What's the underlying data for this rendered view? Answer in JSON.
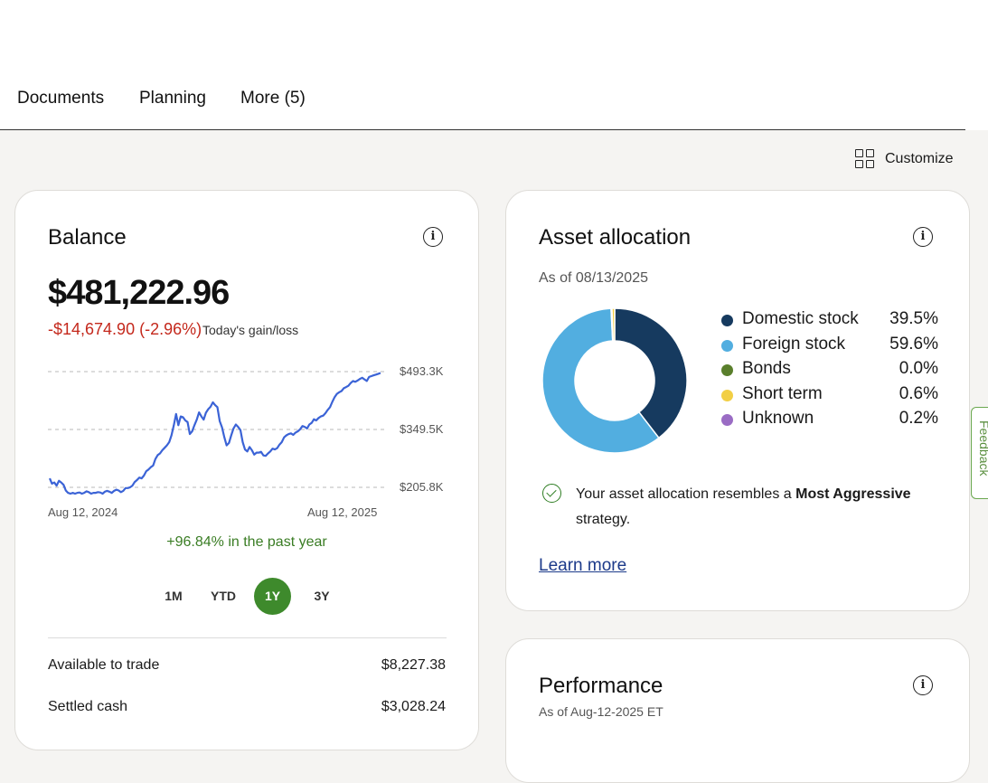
{
  "tabs": [
    {
      "label": "Documents"
    },
    {
      "label": "Planning"
    },
    {
      "label": "More (5)"
    }
  ],
  "customize": {
    "label": "Customize",
    "icon": "grid-icon"
  },
  "balance": {
    "title": "Balance",
    "amount": "$481,222.96",
    "change": "-$14,674.90 (-2.96%)",
    "change_label": "Today's gain/loss",
    "gain_text": "+96.84% in the past year",
    "ranges": [
      "1M",
      "YTD",
      "1Y",
      "3Y"
    ],
    "active_range": "1Y",
    "rows": [
      {
        "label": "Available to trade",
        "value": "$8,227.38"
      },
      {
        "label": "Settled cash",
        "value": "$3,028.24"
      }
    ]
  },
  "chart_data": {
    "type": "line",
    "x_start": "Aug 12, 2024",
    "x_end": "Aug 12, 2025",
    "ytick_labels": [
      "$493.3K",
      "$349.5K",
      "$205.8K"
    ],
    "ylim": [
      205.8,
      493.3
    ],
    "y_unit": "$K",
    "grid": "dashed horizontal",
    "color": "#3b63d6",
    "values": [
      228,
      215,
      218,
      210,
      222,
      218,
      212,
      198,
      192,
      190,
      192,
      190,
      192,
      193,
      190,
      192,
      196,
      194,
      190,
      192,
      192,
      194,
      193,
      190,
      195,
      197,
      195,
      192,
      197,
      200,
      198,
      194,
      197,
      204,
      204,
      206,
      210,
      219,
      224,
      230,
      228,
      235,
      246,
      250,
      256,
      260,
      276,
      286,
      290,
      298,
      304,
      310,
      318,
      335,
      360,
      388,
      360,
      382,
      380,
      372,
      368,
      338,
      345,
      360,
      374,
      392,
      382,
      374,
      391,
      400,
      406,
      417,
      410,
      405,
      370,
      355,
      330,
      310,
      316,
      335,
      352,
      362,
      356,
      348,
      318,
      300,
      295,
      306,
      298,
      287,
      292,
      292,
      294,
      285,
      284,
      290,
      295,
      302,
      300,
      303,
      312,
      318,
      330,
      335,
      338,
      340,
      336,
      342,
      345,
      350,
      358,
      356,
      352,
      362,
      366,
      375,
      372,
      378,
      382,
      384,
      390,
      398,
      405,
      418,
      430,
      438,
      442,
      445,
      452,
      455,
      458,
      465,
      470,
      468,
      471,
      475,
      478,
      474,
      470,
      480,
      482,
      484,
      486,
      488,
      490
    ]
  },
  "asset_allocation": {
    "title": "Asset allocation",
    "as_of": "As of 08/13/2025",
    "items": [
      {
        "name": "Domestic stock",
        "pct": "39.5%",
        "value": 39.5,
        "color": "#163a5f"
      },
      {
        "name": "Foreign stock",
        "pct": "59.6%",
        "value": 59.6,
        "color": "#52aee0"
      },
      {
        "name": "Bonds",
        "pct": "0.0%",
        "value": 0.0,
        "color": "#5a7f2c"
      },
      {
        "name": "Short term",
        "pct": "0.6%",
        "value": 0.6,
        "color": "#f2cf45"
      },
      {
        "name": "Unknown",
        "pct": "0.2%",
        "value": 0.2,
        "color": "#9a6cc4"
      }
    ],
    "resembles_prefix": "Your asset allocation resembles a ",
    "resembles_bold": "Most Aggressive",
    "resembles_suffix": " strategy.",
    "learn_more": "Learn more"
  },
  "performance": {
    "title": "Performance",
    "as_of": "As of Aug-12-2025 ET"
  },
  "feedback": {
    "label": "Feedback"
  },
  "colors": {
    "accent_green": "#3e8a2c",
    "loss_red": "#c4281c",
    "line_blue": "#3b63d6",
    "link_blue": "#1c3a8a"
  }
}
